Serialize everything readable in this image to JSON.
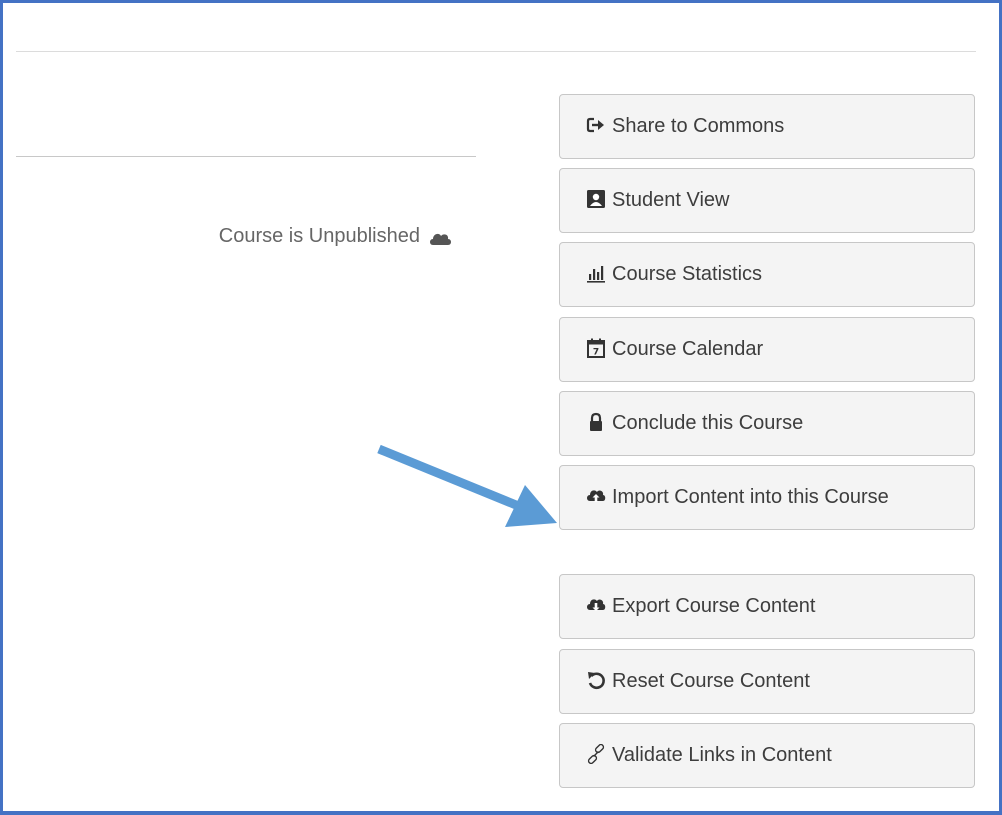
{
  "status": {
    "text": "Course is Unpublished",
    "icon": "cloud-icon"
  },
  "sidebar": {
    "buttons": [
      {
        "label": "Share to Commons",
        "icon": "share-arrow-icon"
      },
      {
        "label": "Student View",
        "icon": "student-view-icon"
      },
      {
        "label": "Course Statistics",
        "icon": "bar-chart-icon"
      },
      {
        "label": "Course Calendar",
        "icon": "calendar-icon"
      },
      {
        "label": "Conclude this Course",
        "icon": "lock-icon"
      },
      {
        "label": "Import Content into this Course",
        "icon": "cloud-upload-icon"
      },
      {
        "label": "Export Course Content",
        "icon": "cloud-download-icon"
      },
      {
        "label": "Reset Course Content",
        "icon": "reset-icon"
      },
      {
        "label": "Validate Links in Content",
        "icon": "link-icon"
      }
    ]
  },
  "colors": {
    "frame_border": "#4472c4",
    "annotation_arrow": "#5b9bd5",
    "button_bg": "#f4f4f4",
    "button_border": "#c7c7c7",
    "text": "#3d3d3d"
  }
}
